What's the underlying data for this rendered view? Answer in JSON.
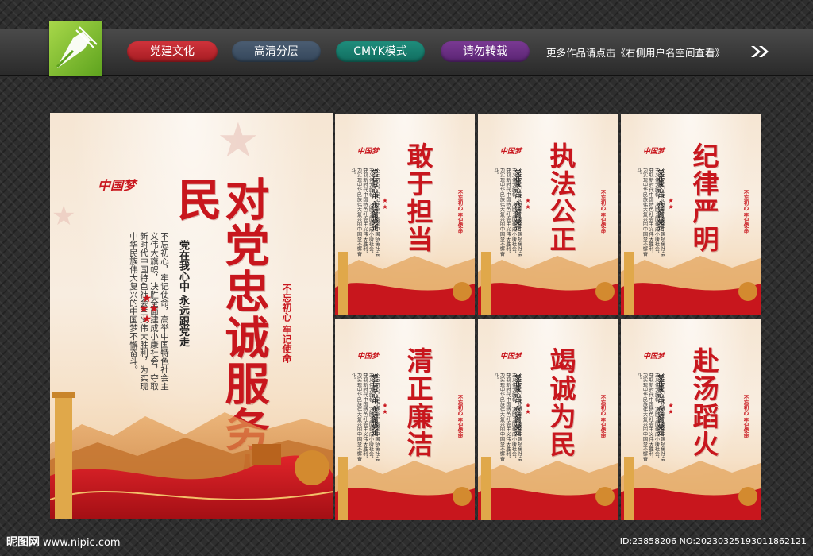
{
  "header": {
    "tags": [
      "党建文化",
      "高清分层",
      "CMYK模式",
      "请勿转载"
    ],
    "more_text": "更多作品请点击《右侧用户名空间查看》",
    "logo_icon": "pen-nib-logo",
    "arrow_icon": "double-chevron-right"
  },
  "posters": {
    "main": {
      "title": "对党忠诚服务人民",
      "dream_logo": "中国梦",
      "slogan": "党在我心中 永远跟党走",
      "body": "不忘初心，牢记使命，高举中国特色社会主义伟大旗帜，决胜全面建成小康社会，夺取新时代中国特色社会主义伟大胜利，为实现中华民族伟大复兴的中国梦不懈奋斗。",
      "motto": "不忘初心 牢记使命"
    },
    "small": [
      {
        "title": "敢于担当",
        "dream_logo": "中国梦",
        "slogan": "党在我心中 永远跟党走",
        "body": "不忘初心，牢记使命，高举中国特色社会主义伟大旗帜，决胜全面建成小康社会，夺取新时代中国特色社会主义伟大胜利，为实现中华民族伟大复兴的中国梦不懈奋斗。",
        "motto": "不忘初心 牢记使命"
      },
      {
        "title": "执法公正",
        "dream_logo": "中国梦",
        "slogan": "党在我心中 永远跟党走",
        "body": "不忘初心，牢记使命，高举中国特色社会主义伟大旗帜，决胜全面建成小康社会，夺取新时代中国特色社会主义伟大胜利，为实现中华民族伟大复兴的中国梦不懈奋斗。",
        "motto": "不忘初心 牢记使命"
      },
      {
        "title": "纪律严明",
        "dream_logo": "中国梦",
        "slogan": "党在我心中 永远跟党走",
        "body": "不忘初心，牢记使命，高举中国特色社会主义伟大旗帜，决胜全面建成小康社会，夺取新时代中国特色社会主义伟大胜利，为实现中华民族伟大复兴的中国梦不懈奋斗。",
        "motto": "不忘初心 牢记使命"
      },
      {
        "title": "清正廉洁",
        "dream_logo": "中国梦",
        "slogan": "党在我心中 永远跟党走",
        "body": "不忘初心，牢记使命，高举中国特色社会主义伟大旗帜，决胜全面建成小康社会，夺取新时代中国特色社会主义伟大胜利，为实现中华民族伟大复兴的中国梦不懈奋斗。",
        "motto": "不忘初心 牢记使命"
      },
      {
        "title": "竭诚为民",
        "dream_logo": "中国梦",
        "slogan": "党在我心中 永远跟党走",
        "body": "不忘初心，牢记使命，高举中国特色社会主义伟大旗帜，决胜全面建成小康社会，夺取新时代中国特色社会主义伟大胜利，为实现中华民族伟大复兴的中国梦不懈奋斗。",
        "motto": "不忘初心 牢记使命"
      },
      {
        "title": "赴汤蹈火",
        "dream_logo": "中国梦",
        "slogan": "党在我心中 永远跟党走",
        "body": "不忘初心，牢记使命，高举中国特色社会主义伟大旗帜，决胜全面建成小康社会，夺取新时代中国特色社会主义伟大胜利，为实现中华民族伟大复兴的中国梦不懈奋斗。",
        "motto": "不忘初心 牢记使命"
      }
    ]
  },
  "watermark": {
    "brand": "昵图网",
    "site": "www.nipic.com",
    "id_text": "ID:23858206 NO:20230325193011862121"
  },
  "colors": {
    "party_red": "#c8161d",
    "poster_bg": "#f6e6d3",
    "page_bg": "#2e2e2e"
  }
}
